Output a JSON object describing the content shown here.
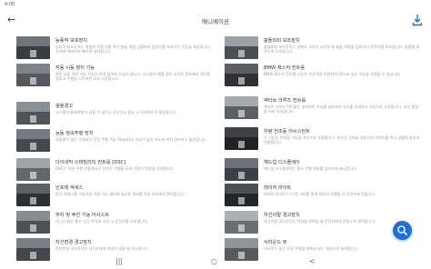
{
  "status": {
    "time": "4:00",
    "right": ""
  },
  "appbar": {
    "title": "애니메이션"
  },
  "items": [
    {
      "title": "능동적 보호장치",
      "desc": "능동적 보호장치는 위험한 주행 상황 혹은 충돌 위험 상황에서 탑승자를 보호하는 기능을 제공합니다. 사고에 대비하여 빠르게 대처합니다."
    },
    {
      "title": "충돌회피 보조장치",
      "desc": "충돌회피 보조장치는 앞에서 차량이 나타날 때 충돌 위험을 감지하고 운전자를 보조합니다. 방향을 바꾸도록 도와줍니다."
    },
    {
      "title": "자동 시동 정지 기능",
      "desc": "엔진 시동 정지 기능 기능은 연료 절약에 도움이 됩니다. 시스템이 예를 들어 교차로 정차에서 엔진을 멈추고 주행을 시작하면 다시 시동합니다."
    },
    {
      "title": "BMW 제스처 컨트롤",
      "desc": "BMW 제스처 컨트롤 기능은 손동작을 이용하여 iDrive 일부 기능을 사용할 수 있습니다."
    },
    {
      "title": "충돌경고",
      "desc": "시스템이 충돌위험이 있을 수 있다고 경고하고 필요 시 자체적으로 제동합니다."
    },
    {
      "title": "액티브 크루즈 컨트롤",
      "desc": "액티브 크루즈 컨트롤은 앞차와의 거리를 설정하면 속도를 유지하고 자동으로 조절합니다. 차선 중앙을 따라 유지합니다."
    },
    {
      "title": "능동 정속주행 장치",
      "desc": "교통량이 많은 곳에서도 간단 주행 기능 Stop&Go 기능이 앞차 속도에 따라 정지하고 출발합니다."
    },
    {
      "title": "차량 전조등 어시스턴트",
      "desc": "이 기능은 전조등 기능을 자동으로 조절합니다. 어두운 곳에서 자동으로 라이트를 켜고 상황에 맞추어 전환합니다."
    },
    {
      "title": "다이내믹 스태빌리티 컨트롤 [DSC]",
      "desc": "DSC는 어떤 주행 상황에서도 안정적 주행을 도와 차량의 안정을 유지합니다."
    },
    {
      "title": "헤드업 디스플레이",
      "desc": "헤드업 디스플레이는 중요 주행 정보를 앞유리에 표시합니다."
    },
    {
      "title": "인포테 엑세스",
      "desc": "원격 엑세스를 이용하면 차량 기능 제어에 필요한 정보를 차량 외부에서 확인합니다."
    },
    {
      "title": "레이저 라이트",
      "desc": "레이저 라이트는 더 먼 거리를 밝게 비추어 주행을 더 안전하게 만듭니다."
    },
    {
      "title": "주차 및 후진 기능 어시스트",
      "desc": "이 시스템은 좁은 공간 주차와 후진 시 운전자를 보조합니다."
    },
    {
      "title": "차선이탈 경고장치",
      "desc": "차선이탈 경고장치는 차선을 벗어날 때 운전자에게 진동으로 알려줍니다."
    },
    {
      "title": "차선변경 경고장치",
      "desc": "차선변경 경고장치는 사각지대에 차량이 있을 때 경고합니다."
    },
    {
      "title": "서라운드 뷰",
      "desc": "서라운드 뷰는 차량 주변을 위에서 보는 영상으로 보여줍니다."
    }
  ],
  "colors": {
    "accent": "#1e6fd9"
  },
  "icons": {
    "back": "←",
    "download": "download-icon",
    "search": "search-icon"
  },
  "nav": {
    "recent": "|||",
    "home": "○",
    "back": "<"
  }
}
